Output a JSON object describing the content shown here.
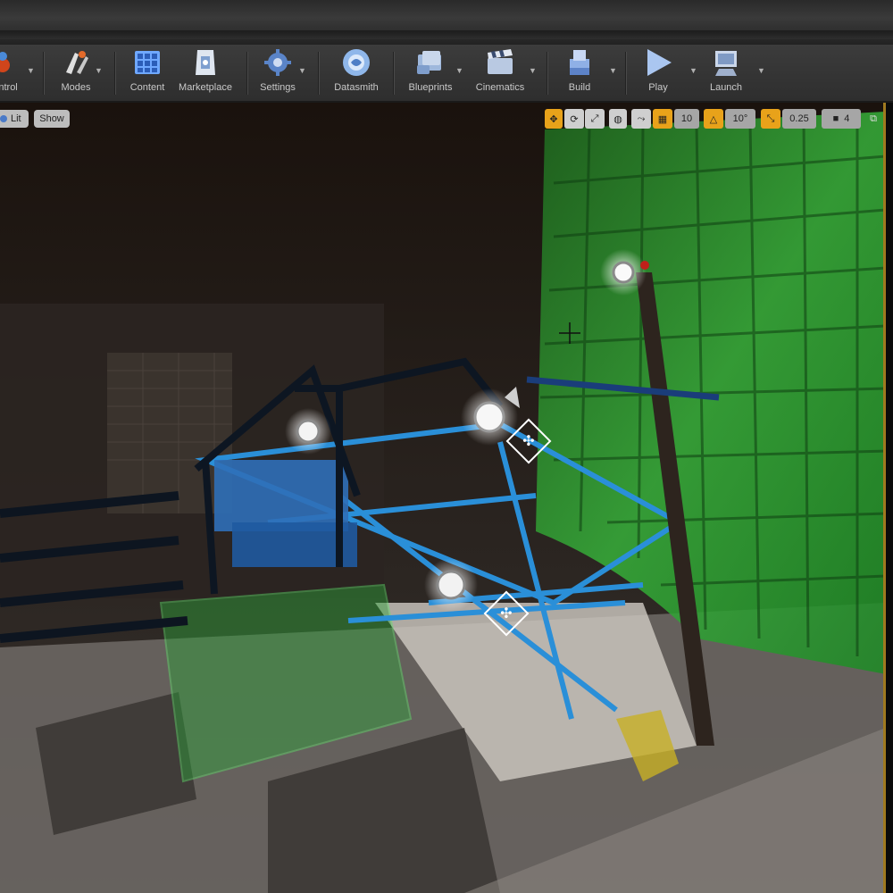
{
  "toolbar": {
    "items": [
      {
        "label": "ontrol",
        "icon": "source-control-icon"
      },
      {
        "label": "Modes",
        "icon": "modes-icon"
      },
      {
        "label": "Content",
        "icon": "content-icon"
      },
      {
        "label": "Marketplace",
        "icon": "marketplace-icon"
      },
      {
        "label": "Settings",
        "icon": "settings-icon"
      },
      {
        "label": "Datasmith",
        "icon": "datasmith-icon"
      },
      {
        "label": "Blueprints",
        "icon": "blueprints-icon"
      },
      {
        "label": "Cinematics",
        "icon": "cinematics-icon"
      },
      {
        "label": "Build",
        "icon": "build-icon"
      },
      {
        "label": "Play",
        "icon": "play-icon"
      },
      {
        "label": "Launch",
        "icon": "launch-icon"
      }
    ]
  },
  "viewport": {
    "view_mode": "Lit",
    "show_label": "Show",
    "grid_snap": "10",
    "rotation_snap": "10°",
    "scale_snap": "0.25",
    "camera_speed": "4"
  },
  "colors": {
    "accent": "#e8a21a",
    "green_screen": "#2fae3a",
    "rig_blue": "#2a8fd8"
  }
}
